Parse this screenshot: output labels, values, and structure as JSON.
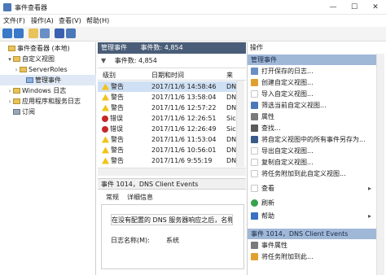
{
  "window": {
    "title": "事件查看器",
    "minimize": "—",
    "maximize": "☐",
    "close": "✕"
  },
  "menu": [
    "文件(F)",
    "操作(A)",
    "查看(V)",
    "帮助(H)"
  ],
  "tree": [
    {
      "label": "事件查看器 (本地)",
      "arrow": "",
      "selected": false
    },
    {
      "label": "自定义视图",
      "arrow": "▾",
      "selected": false
    },
    {
      "label": "ServerRoles",
      "arrow": "›",
      "selected": false
    },
    {
      "label": "管理事件",
      "arrow": "",
      "selected": true
    },
    {
      "label": "Windows 日志",
      "arrow": "›",
      "selected": false
    },
    {
      "label": "应用程序和服务日志",
      "arrow": "›",
      "selected": false
    },
    {
      "label": "订阅",
      "arrow": "",
      "selected": false
    }
  ],
  "center": {
    "header_title": "管理事件",
    "header_count": "事件数: 4,854",
    "filter_text": "事件数: 4,854",
    "columns": [
      "级别",
      "日期和时间",
      "来"
    ],
    "rows": [
      {
        "level": "警告",
        "type": "warn",
        "date": "2017/11/6 14:58:46",
        "src": "DN"
      },
      {
        "level": "警告",
        "type": "warn",
        "date": "2017/11/6 13:58:04",
        "src": "DN"
      },
      {
        "level": "警告",
        "type": "warn",
        "date": "2017/11/6 12:57:22",
        "src": "DN"
      },
      {
        "level": "错误",
        "type": "err",
        "date": "2017/11/6 12:26:51",
        "src": "Sic"
      },
      {
        "level": "错误",
        "type": "err",
        "date": "2017/11/6 12:26:49",
        "src": "Sic"
      },
      {
        "level": "警告",
        "type": "warn",
        "date": "2017/11/6 11:53:04",
        "src": "DN"
      },
      {
        "level": "警告",
        "type": "warn",
        "date": "2017/11/6 10:56:01",
        "src": "DN"
      },
      {
        "level": "警告",
        "type": "warn",
        "date": "2017/11/6 9:55:19",
        "src": "DN"
      }
    ]
  },
  "detail": {
    "header": "事件 1014，DNS Client Events",
    "tabs": [
      "常规",
      "详细信息"
    ],
    "message": "在没有配置的 DNS 服务器响应之后，名称 w",
    "log_name_label": "日志名称(M):",
    "log_name_value": "系统"
  },
  "actions": {
    "title": "操作",
    "section1": "管理事件",
    "items1": [
      {
        "label": "打开保存的日志...",
        "icon": "#6a8fc4"
      },
      {
        "label": "创建自定义视图...",
        "icon": "#e0a030"
      },
      {
        "label": "导入自定义视图...",
        "icon": "#ffffff"
      },
      {
        "label": "筛选当前自定义视图...",
        "icon": "#4a78b8"
      },
      {
        "label": "属性",
        "icon": "#7a7a7a"
      },
      {
        "label": "查找...",
        "icon": "#5a5a5a"
      },
      {
        "label": "将自定义视图中的所有事件另存为...",
        "icon": "#3a5a8a"
      },
      {
        "label": "导出自定义视图...",
        "icon": "#ffffff"
      },
      {
        "label": "复制自定义视图...",
        "icon": "#ffffff"
      },
      {
        "label": "将任务附加到此自定义视图...",
        "icon": "#ffffff"
      },
      {
        "label": "查看",
        "icon": "#ffffff"
      },
      {
        "label": "刷新",
        "icon": "#3aa04a"
      },
      {
        "label": "帮助",
        "icon": "#3a6fc4"
      }
    ],
    "section2": "事件 1014，DNS Client Events",
    "items2": [
      {
        "label": "事件属性",
        "icon": "#7a7a7a"
      },
      {
        "label": "将任务附加到此...",
        "icon": "#e0a030"
      }
    ]
  }
}
